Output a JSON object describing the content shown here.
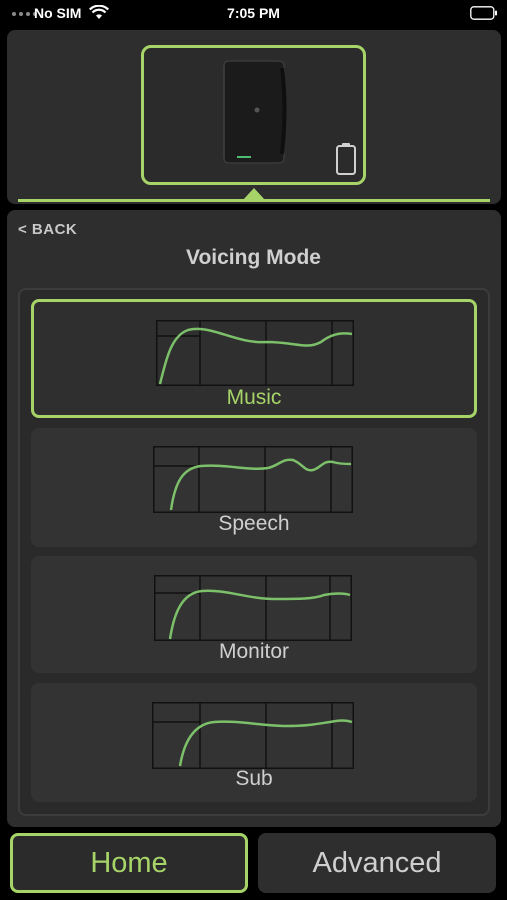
{
  "status_bar": {
    "carrier": "No SIM",
    "time": "7:05 PM"
  },
  "navigation": {
    "back_label": "< BACK"
  },
  "page": {
    "title": "Voicing Mode"
  },
  "modes": [
    {
      "label": "Music",
      "selected": true
    },
    {
      "label": "Speech",
      "selected": false
    },
    {
      "label": "Monitor",
      "selected": false
    },
    {
      "label": "Sub",
      "selected": false
    }
  ],
  "tabs": {
    "home": "Home",
    "advanced": "Advanced"
  },
  "colors": {
    "accent": "#a7d468",
    "panel": "#2e2e2e",
    "text": "#cfcfcf"
  }
}
